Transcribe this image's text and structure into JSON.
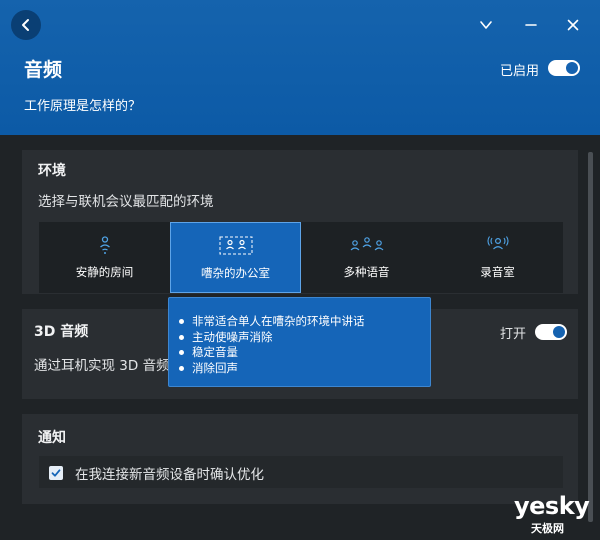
{
  "header": {
    "title": "音频",
    "how_link": "工作原理是怎样的？",
    "enabled_label": "已启用",
    "enabled": true
  },
  "environment": {
    "title": "环境",
    "subtitle": "选择与联机会议最匹配的环境",
    "options": [
      {
        "label": "安静的房间",
        "icon": "quiet-room-icon",
        "selected": false
      },
      {
        "label": "嘈杂的办公室",
        "icon": "noisy-office-icon",
        "selected": true
      },
      {
        "label": "多种语音",
        "icon": "multiple-voices-icon",
        "selected": false
      },
      {
        "label": "录音室",
        "icon": "studio-icon",
        "selected": false
      }
    ],
    "tooltip_items": [
      "非常适合单人在嘈杂的环境中讲话",
      "主动使噪声消除",
      "稳定音量",
      "消除回声"
    ]
  },
  "audio3d": {
    "title": "3D 音频",
    "subtitle": "通过耳机实现 3D 音频",
    "toggle_label": "打开",
    "enabled": true
  },
  "notification": {
    "title": "通知",
    "checkbox_label": "在我连接新音频设备时确认优化",
    "checked": true
  },
  "watermark": {
    "main": "yesky",
    "sub": "天极网"
  },
  "colors": {
    "header": "#0c5aa6",
    "accent": "#1565b8",
    "background": "#1f2326",
    "panel": "#2a2e32"
  }
}
